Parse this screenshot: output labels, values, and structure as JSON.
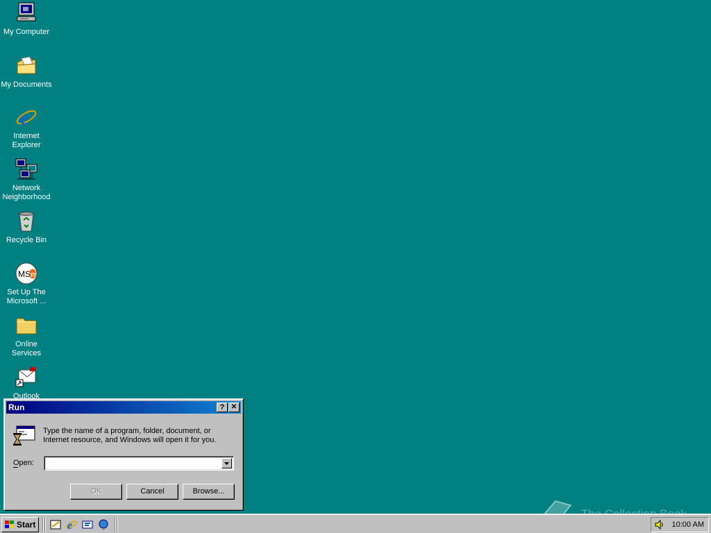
{
  "desktop": {
    "icons": [
      {
        "label": "My Computer"
      },
      {
        "label": "My Documents"
      },
      {
        "label": "Internet Explorer"
      },
      {
        "label": "Network Neighborhood"
      },
      {
        "label": "Recycle Bin"
      },
      {
        "label": "Set Up The Microsoft ..."
      },
      {
        "label": "Online Services"
      },
      {
        "label": "Outlook"
      }
    ]
  },
  "run_dialog": {
    "title": "Run",
    "help_button": "?",
    "close_button": "✕",
    "description": "Type the name of a program, folder, document, or Internet resource, and Windows will open it for you.",
    "open_label": "Open:",
    "open_value": "",
    "ok_label": "OK",
    "cancel_label": "Cancel",
    "browse_label": "Browse..."
  },
  "taskbar": {
    "start_label": "Start",
    "quick_launch": [
      "show-desktop-icon",
      "internet-explorer-icon",
      "view-channels-icon",
      "outlook-express-icon"
    ],
    "clock": "10:00 AM"
  },
  "watermark": "The Collection Book",
  "colors": {
    "desktop": "#008080",
    "titlebar_start": "#000080",
    "titlebar_end": "#1084d0",
    "face": "#c0c0c0"
  }
}
